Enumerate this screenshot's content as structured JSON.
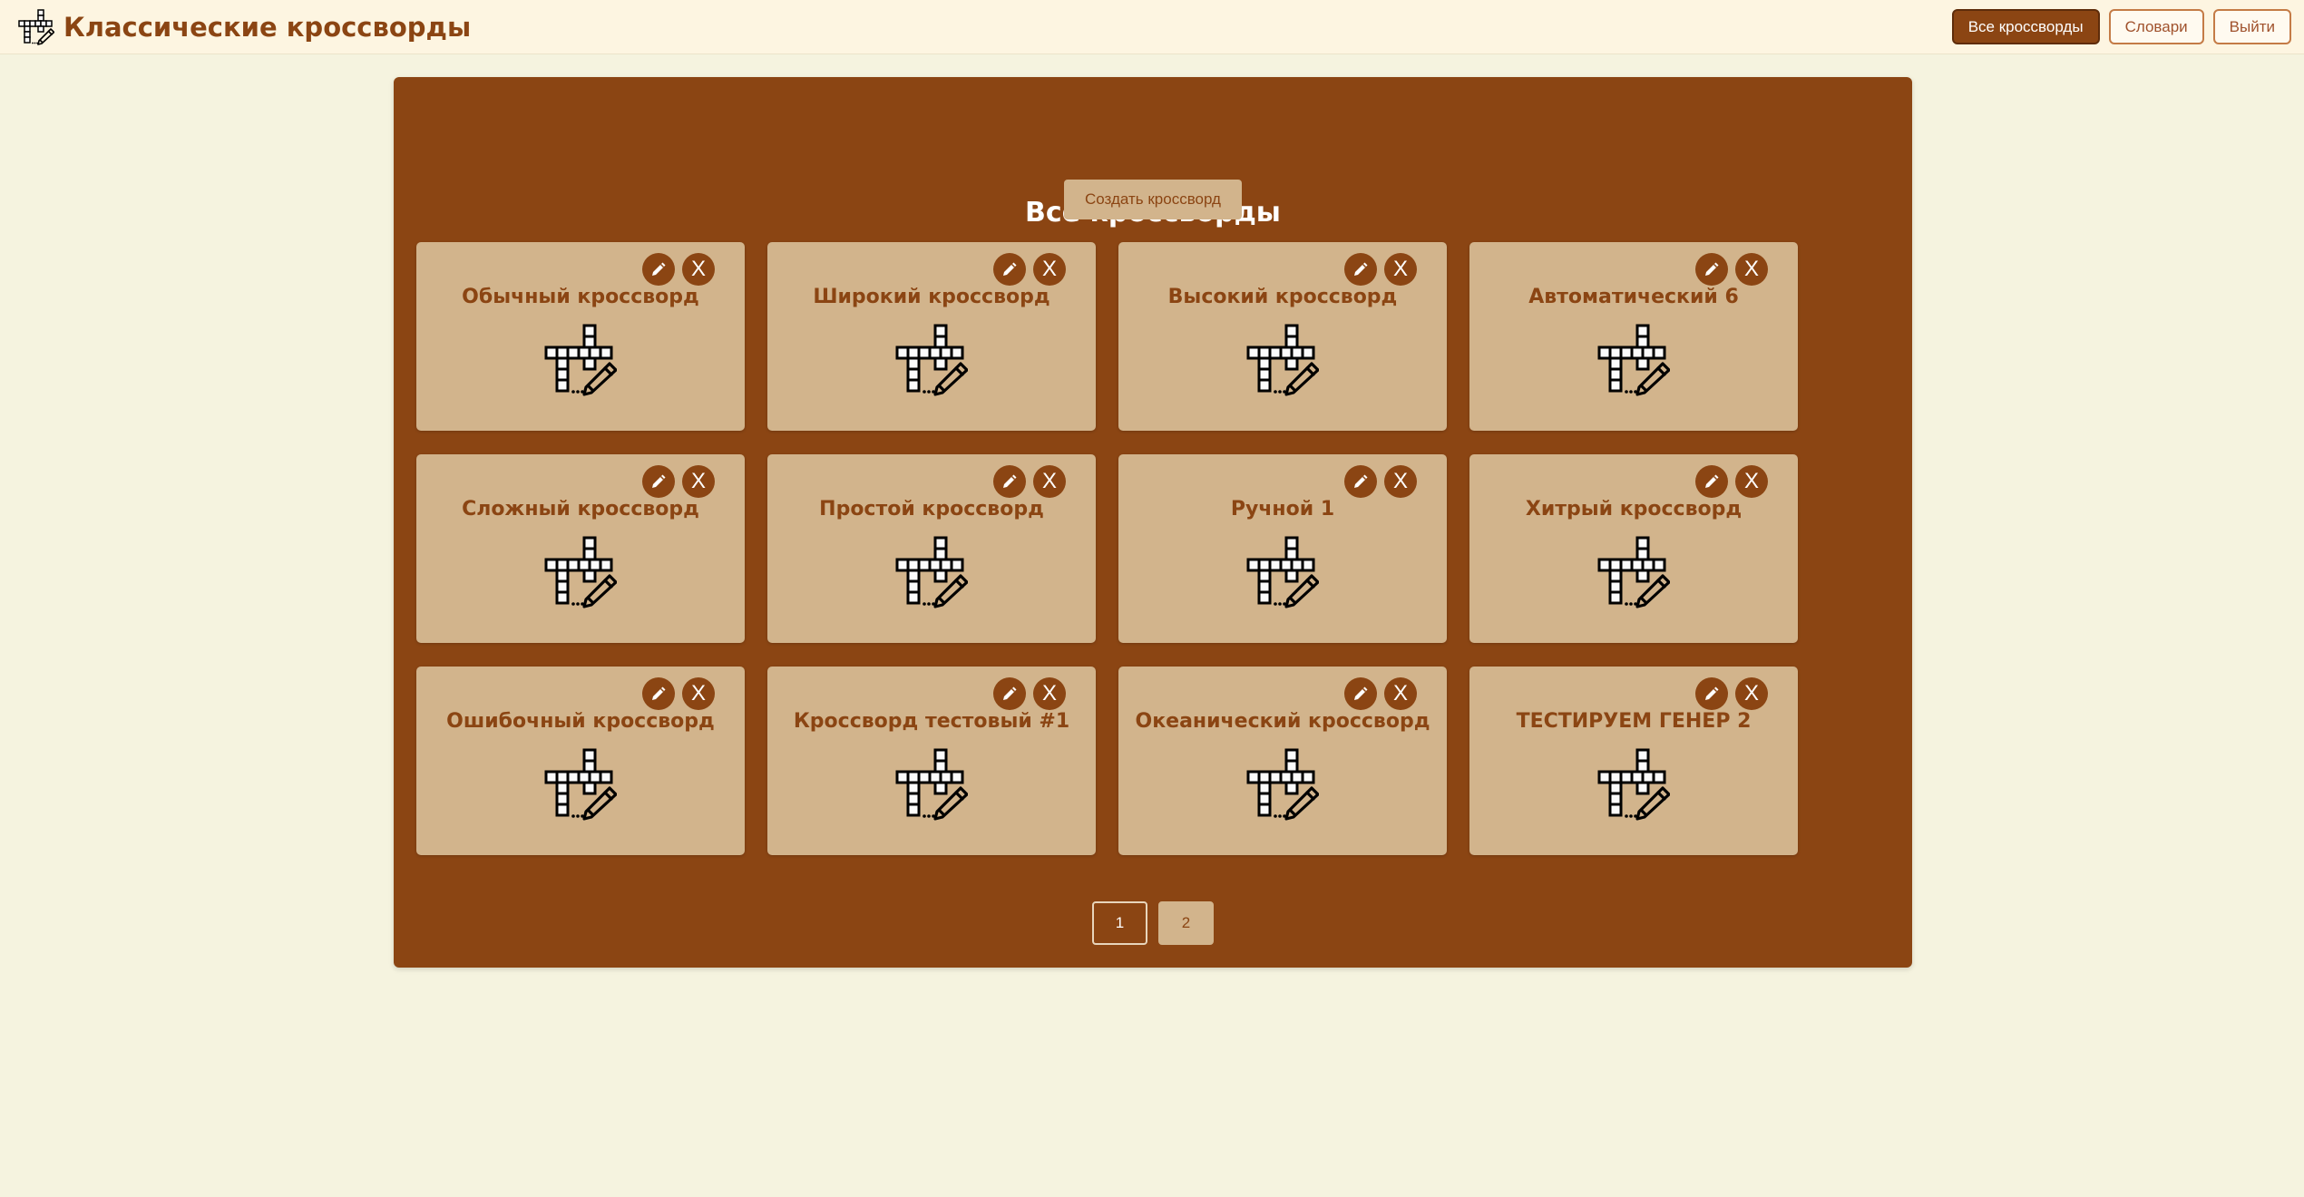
{
  "header": {
    "logo_icon": "crossword-pencil-icon",
    "title": "Классические кроссворды",
    "nav": [
      {
        "label": "Все кроссворды",
        "active": true
      },
      {
        "label": "Словари",
        "active": false
      },
      {
        "label": "Выйти",
        "active": false
      }
    ]
  },
  "main": {
    "title": "Все кроссворды",
    "create_label": "Создать кроссворд",
    "delete_label": "X",
    "cards": [
      {
        "title": "Обычный кроссворд"
      },
      {
        "title": "Широкий кроссворд"
      },
      {
        "title": "Высокий кроссворд"
      },
      {
        "title": "Автоматический 6"
      },
      {
        "title": "Сложный кроссворд"
      },
      {
        "title": "Простой кроссворд"
      },
      {
        "title": "Ручной 1"
      },
      {
        "title": "Хитрый кроссворд"
      },
      {
        "title": "Ошибочный кроссворд"
      },
      {
        "title": "Кроссворд тестовый #1"
      },
      {
        "title": "Океанический кроссворд"
      },
      {
        "title": "ТЕСТИРУЕМ ГЕНЕР 2"
      }
    ],
    "pagination": [
      {
        "label": "1",
        "current": true
      },
      {
        "label": "2",
        "current": false
      }
    ]
  },
  "colors": {
    "accent": "#8b4513",
    "card": "#d2b48c",
    "background": "#f5f3df",
    "header": "#fdf5e1"
  }
}
